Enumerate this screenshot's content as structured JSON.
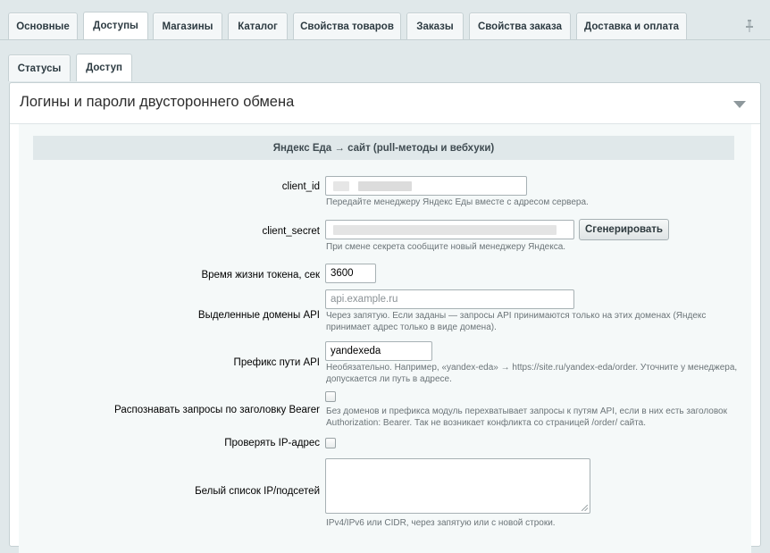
{
  "tabs_main": [
    {
      "label": "Основные",
      "active": false
    },
    {
      "label": "Доступы",
      "active": true
    },
    {
      "label": "Магазины",
      "active": false
    },
    {
      "label": "Каталог",
      "active": false
    },
    {
      "label": "Свойства товаров",
      "active": false
    },
    {
      "label": "Заказы",
      "active": false
    },
    {
      "label": "Свойства заказа",
      "active": false
    },
    {
      "label": "Доставка и оплата",
      "active": false
    }
  ],
  "tabs_sub": [
    {
      "label": "Статусы",
      "active": false
    },
    {
      "label": "Доступ",
      "active": true
    }
  ],
  "panel": {
    "title": "Логины и пароли двустороннего обмена",
    "section_heading": "Яндекс Еда → сайт (pull-методы и вебхуки)"
  },
  "form": {
    "client_id": {
      "label": "client_id",
      "value": "",
      "hint": "Передайте менеджеру Яндекс Еды вместе с адресом сервера."
    },
    "client_secret": {
      "label": "client_secret",
      "value": "",
      "hint": "При смене секрета сообщите новый менеджеру Яндекса.",
      "button_label": "Сгенерировать"
    },
    "token_ttl": {
      "label": "Время жизни токена, сек",
      "value": "3600"
    },
    "api_domains": {
      "label": "Выделенные домены API",
      "value": "",
      "placeholder": "api.example.ru",
      "hint_line1": "Через запятую. Если заданы — запросы API принимаются только на этих доменах (Яндекс",
      "hint_line2": "принимает адрес только в виде домена)."
    },
    "api_prefix": {
      "label": "Префикс пути API",
      "value": "yandexeda",
      "hint_line1": "Необязательно. Например, «yandex-eda» → https://site.ru/yandex-eda/order. Уточните у менеджера,",
      "hint_line2": "допускается ли путь в адресе."
    },
    "bearer": {
      "label": "Распознавать запросы по заголовку Bearer",
      "checked": false,
      "hint_line1": "Без доменов и префикса модуль перехватывает запросы к путям API, если в них есть заголовок",
      "hint_line2": "Authorization: Bearer. Так не возникает конфликта со страницей /order/ сайта."
    },
    "check_ip": {
      "label": "Проверять IP-адрес",
      "checked": false
    },
    "ip_whitelist": {
      "label": "Белый список IP/подсетей",
      "value": "",
      "hint": "IPv4/IPv6 или CIDR, через запятую или с новой строки."
    }
  },
  "icons": {
    "pin": "pin-icon",
    "collapse": "chevron-down-icon",
    "resize": "resize-handle-icon"
  },
  "colors": {
    "page_bg": "#e0e8ea",
    "panel_bg": "#ffffff",
    "section_bg": "#e0e8ea",
    "hint_text": "#6b7478"
  }
}
